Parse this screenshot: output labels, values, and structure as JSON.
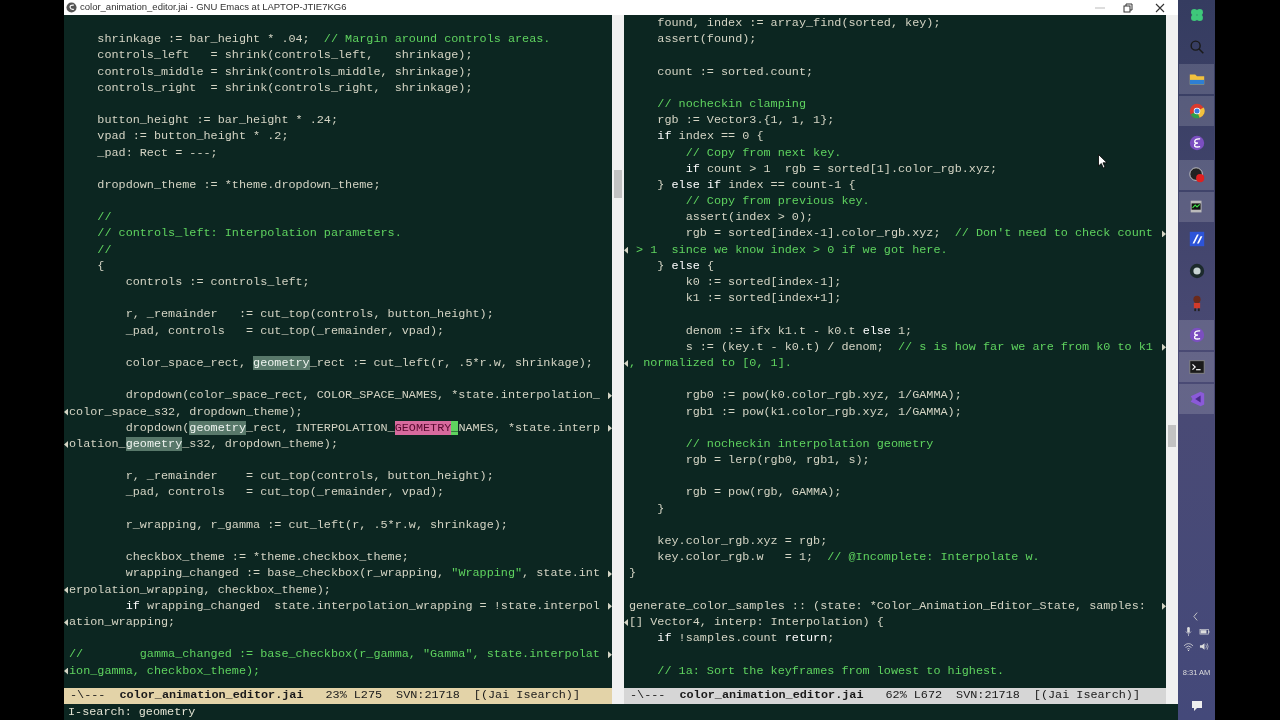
{
  "window": {
    "title": "color_animation_editor.jai - GNU Emacs at LAPTOP-JTIE7KG6"
  },
  "panes": [
    {
      "active": true,
      "lines": [
        {
          "kind": "blank"
        },
        {
          "kind": "text",
          "wraps": false,
          "continues": false,
          "segments": [
            {
              "kind": "code",
              "text": "    shrinkage := bar_height * .04;  "
            },
            {
              "kind": "comment",
              "text": "// Margin around controls areas."
            }
          ]
        },
        {
          "kind": "text",
          "wraps": false,
          "continues": false,
          "segments": [
            {
              "kind": "code",
              "text": "    controls_left   = shrink(controls_left,   shrinkage);"
            }
          ]
        },
        {
          "kind": "text",
          "wraps": false,
          "continues": false,
          "segments": [
            {
              "kind": "code",
              "text": "    controls_middle = shrink(controls_middle, shrinkage);"
            }
          ]
        },
        {
          "kind": "text",
          "wraps": false,
          "continues": false,
          "segments": [
            {
              "kind": "code",
              "text": "    controls_right  = shrink(controls_right,  shrinkage);"
            }
          ]
        },
        {
          "kind": "blank"
        },
        {
          "kind": "text",
          "wraps": false,
          "continues": false,
          "segments": [
            {
              "kind": "code",
              "text": "    button_height := bar_height * .24;"
            }
          ]
        },
        {
          "kind": "text",
          "wraps": false,
          "continues": false,
          "segments": [
            {
              "kind": "code",
              "text": "    vpad := button_height * .2;"
            }
          ]
        },
        {
          "kind": "text",
          "wraps": false,
          "continues": false,
          "segments": [
            {
              "kind": "code",
              "text": "    _pad: Rect = ---;"
            }
          ]
        },
        {
          "kind": "blank"
        },
        {
          "kind": "text",
          "wraps": false,
          "continues": false,
          "segments": [
            {
              "kind": "code",
              "text": "    dropdown_theme := *theme.dropdown_theme;"
            }
          ]
        },
        {
          "kind": "blank"
        },
        {
          "kind": "text",
          "wraps": false,
          "continues": false,
          "segments": [
            {
              "kind": "comment",
              "text": "    //"
            }
          ]
        },
        {
          "kind": "text",
          "wraps": false,
          "continues": false,
          "segments": [
            {
              "kind": "comment",
              "text": "    // controls_left: Interpolation parameters."
            }
          ]
        },
        {
          "kind": "text",
          "wraps": false,
          "continues": false,
          "segments": [
            {
              "kind": "comment",
              "text": "    //"
            }
          ]
        },
        {
          "kind": "text",
          "wraps": false,
          "continues": false,
          "segments": [
            {
              "kind": "code",
              "text": "    {"
            }
          ]
        },
        {
          "kind": "text",
          "wraps": false,
          "continues": false,
          "segments": [
            {
              "kind": "code",
              "text": "        controls := controls_left;"
            }
          ]
        },
        {
          "kind": "blank"
        },
        {
          "kind": "text",
          "wraps": false,
          "continues": false,
          "segments": [
            {
              "kind": "code",
              "text": "        r, _remainder   := cut_top(controls, button_height);"
            }
          ]
        },
        {
          "kind": "text",
          "wraps": false,
          "continues": false,
          "segments": [
            {
              "kind": "code",
              "text": "        _pad, controls   = cut_top(_remainder, vpad);"
            }
          ]
        },
        {
          "kind": "blank"
        },
        {
          "kind": "text",
          "wraps": false,
          "continues": false,
          "segments": [
            {
              "kind": "code",
              "text": "        color_space_rect, "
            },
            {
              "kind": "match",
              "text": "geometry"
            },
            {
              "kind": "code",
              "text": "_rect := cut_left(r, .5*r.w, shrinkage);"
            }
          ]
        },
        {
          "kind": "blank"
        },
        {
          "kind": "text",
          "wraps": true,
          "continues": false,
          "segments": [
            {
              "kind": "code",
              "text": "        dropdown(color_space_rect, COLOR_SPACE_NAMES, *state.interpolation_"
            }
          ]
        },
        {
          "kind": "text",
          "wraps": false,
          "continues": true,
          "segments": [
            {
              "kind": "code",
              "text": "color_space_s32, dropdown_theme);"
            }
          ]
        },
        {
          "kind": "text",
          "wraps": true,
          "continues": false,
          "segments": [
            {
              "kind": "code",
              "text": "        dropdown("
            },
            {
              "kind": "match",
              "text": "geometry"
            },
            {
              "kind": "code",
              "text": "_rect, INTERPOLATION_"
            },
            {
              "kind": "current",
              "text": "GEOMETRY"
            },
            {
              "kind": "cursor",
              "text": "_"
            },
            {
              "kind": "code",
              "text": "NAMES, *state.interp"
            }
          ]
        },
        {
          "kind": "text",
          "wraps": false,
          "continues": true,
          "segments": [
            {
              "kind": "code",
              "text": "olation_"
            },
            {
              "kind": "match",
              "text": "geometry"
            },
            {
              "kind": "code",
              "text": "_s32, dropdown_theme);"
            }
          ]
        },
        {
          "kind": "blank"
        },
        {
          "kind": "text",
          "wraps": false,
          "continues": false,
          "segments": [
            {
              "kind": "code",
              "text": "        r, _remainder    = cut_top(controls, button_height);"
            }
          ]
        },
        {
          "kind": "text",
          "wraps": false,
          "continues": false,
          "segments": [
            {
              "kind": "code",
              "text": "        _pad, controls   = cut_top(_remainder, vpad);"
            }
          ]
        },
        {
          "kind": "blank"
        },
        {
          "kind": "text",
          "wraps": false,
          "continues": false,
          "segments": [
            {
              "kind": "code",
              "text": "        r_wrapping, r_gamma := cut_left(r, .5*r.w, shrinkage);"
            }
          ]
        },
        {
          "kind": "blank"
        },
        {
          "kind": "text",
          "wraps": false,
          "continues": false,
          "segments": [
            {
              "kind": "code",
              "text": "        checkbox_theme := *theme.checkbox_theme;"
            }
          ]
        },
        {
          "kind": "text",
          "wraps": true,
          "continues": false,
          "segments": [
            {
              "kind": "code",
              "text": "        wrapping_changed := base_checkbox(r_wrapping, "
            },
            {
              "kind": "string",
              "text": "\"Wrapping\""
            },
            {
              "kind": "code",
              "text": ", state.int"
            }
          ]
        },
        {
          "kind": "text",
          "wraps": false,
          "continues": true,
          "segments": [
            {
              "kind": "code",
              "text": "erpolation_wrapping, checkbox_theme);"
            }
          ]
        },
        {
          "kind": "text",
          "wraps": true,
          "continues": false,
          "segments": [
            {
              "kind": "keyword",
              "text": "        if"
            },
            {
              "kind": "code",
              "text": " wrapping_changed  state.interpolation_wrapping = !state.interpol"
            }
          ]
        },
        {
          "kind": "text",
          "wraps": false,
          "continues": true,
          "segments": [
            {
              "kind": "code",
              "text": "ation_wrapping;"
            }
          ]
        },
        {
          "kind": "blank"
        },
        {
          "kind": "text",
          "wraps": true,
          "continues": false,
          "segments": [
            {
              "kind": "comment",
              "text": "//        gamma_changed := base_checkbox(r_gamma, \"Gamma\", state.interpolat"
            }
          ]
        },
        {
          "kind": "text",
          "wraps": false,
          "continues": true,
          "segments": [
            {
              "kind": "comment",
              "text": "ion_gamma, checkbox_theme);"
            }
          ]
        }
      ],
      "mode_line": {
        "status": "-\\---",
        "buffer": "color_animation_editor.jai",
        "position": "23% L275",
        "vc": "SVN:21718",
        "mode": "[(Jai Isearch)]"
      }
    },
    {
      "active": false,
      "lines": [
        {
          "kind": "text",
          "wraps": false,
          "continues": false,
          "segments": [
            {
              "kind": "code",
              "text": "    found, index := array_find(sorted, key);"
            }
          ]
        },
        {
          "kind": "text",
          "wraps": false,
          "continues": false,
          "segments": [
            {
              "kind": "code",
              "text": "    assert(found);"
            }
          ]
        },
        {
          "kind": "blank"
        },
        {
          "kind": "text",
          "wraps": false,
          "continues": false,
          "segments": [
            {
              "kind": "code",
              "text": "    count := sorted.count;"
            }
          ]
        },
        {
          "kind": "blank"
        },
        {
          "kind": "text",
          "wraps": false,
          "continues": false,
          "segments": [
            {
              "kind": "comment",
              "text": "    // nocheckin clamping"
            }
          ]
        },
        {
          "kind": "text",
          "wraps": false,
          "continues": false,
          "segments": [
            {
              "kind": "code",
              "text": "    rgb := Vector3.{1, 1, 1};"
            }
          ]
        },
        {
          "kind": "text",
          "wraps": false,
          "continues": false,
          "segments": [
            {
              "kind": "keyword",
              "text": "    if"
            },
            {
              "kind": "code",
              "text": " index == 0 {"
            }
          ]
        },
        {
          "kind": "text",
          "wraps": false,
          "continues": false,
          "segments": [
            {
              "kind": "comment",
              "text": "        // Copy from next key."
            }
          ]
        },
        {
          "kind": "text",
          "wraps": false,
          "continues": false,
          "segments": [
            {
              "kind": "keyword",
              "text": "        if"
            },
            {
              "kind": "code",
              "text": " count > 1  rgb = sorted[1].color_rgb.xyz;"
            }
          ]
        },
        {
          "kind": "text",
          "wraps": false,
          "continues": false,
          "segments": [
            {
              "kind": "code",
              "text": "    } "
            },
            {
              "kind": "keyword",
              "text": "else if"
            },
            {
              "kind": "code",
              "text": " index == count-1 {"
            }
          ]
        },
        {
          "kind": "text",
          "wraps": false,
          "continues": false,
          "segments": [
            {
              "kind": "comment",
              "text": "        // Copy from previous key."
            }
          ]
        },
        {
          "kind": "text",
          "wraps": false,
          "continues": false,
          "segments": [
            {
              "kind": "code",
              "text": "        assert(index > 0);"
            }
          ]
        },
        {
          "kind": "text",
          "wraps": true,
          "continues": false,
          "segments": [
            {
              "kind": "code",
              "text": "        rgb = sorted[index-1].color_rgb.xyz;  "
            },
            {
              "kind": "comment",
              "text": "// Don't need to check count"
            }
          ]
        },
        {
          "kind": "text",
          "wraps": false,
          "continues": true,
          "segments": [
            {
              "kind": "comment",
              "text": " > 1  since we know index > 0 if we got here."
            }
          ]
        },
        {
          "kind": "text",
          "wraps": false,
          "continues": false,
          "segments": [
            {
              "kind": "code",
              "text": "    } "
            },
            {
              "kind": "keyword",
              "text": "else"
            },
            {
              "kind": "code",
              "text": " {"
            }
          ]
        },
        {
          "kind": "text",
          "wraps": false,
          "continues": false,
          "segments": [
            {
              "kind": "code",
              "text": "        k0 := sorted[index-1];"
            }
          ]
        },
        {
          "kind": "text",
          "wraps": false,
          "continues": false,
          "segments": [
            {
              "kind": "code",
              "text": "        k1 := sorted[index+1];"
            }
          ]
        },
        {
          "kind": "blank"
        },
        {
          "kind": "text",
          "wraps": false,
          "continues": false,
          "segments": [
            {
              "kind": "code",
              "text": "        denom := ifx k1.t - k0.t "
            },
            {
              "kind": "keyword",
              "text": "else"
            },
            {
              "kind": "code",
              "text": " 1;"
            }
          ]
        },
        {
          "kind": "text",
          "wraps": true,
          "continues": false,
          "segments": [
            {
              "kind": "code",
              "text": "        s := (key.t - k0.t) / denom;  "
            },
            {
              "kind": "comment",
              "text": "// s is how far we are from k0 to k1"
            }
          ]
        },
        {
          "kind": "text",
          "wraps": false,
          "continues": true,
          "segments": [
            {
              "kind": "comment",
              "text": ", normalized to [0, 1]."
            }
          ]
        },
        {
          "kind": "blank"
        },
        {
          "kind": "text",
          "wraps": false,
          "continues": false,
          "segments": [
            {
              "kind": "code",
              "text": "        rgb0 := pow(k0.color_rgb.xyz, 1/GAMMA);"
            }
          ]
        },
        {
          "kind": "text",
          "wraps": false,
          "continues": false,
          "segments": [
            {
              "kind": "code",
              "text": "        rgb1 := pow(k1.color_rgb.xyz, 1/GAMMA);"
            }
          ]
        },
        {
          "kind": "blank"
        },
        {
          "kind": "text",
          "wraps": false,
          "continues": false,
          "segments": [
            {
              "kind": "comment",
              "text": "        // nocheckin interpolation geometry"
            }
          ]
        },
        {
          "kind": "text",
          "wraps": false,
          "continues": false,
          "segments": [
            {
              "kind": "code",
              "text": "        rgb = lerp(rgb0, rgb1, s);"
            }
          ]
        },
        {
          "kind": "blank"
        },
        {
          "kind": "text",
          "wraps": false,
          "continues": false,
          "segments": [
            {
              "kind": "code",
              "text": "        rgb = pow(rgb, GAMMA);"
            }
          ]
        },
        {
          "kind": "text",
          "wraps": false,
          "continues": false,
          "segments": [
            {
              "kind": "code",
              "text": "    }"
            }
          ]
        },
        {
          "kind": "blank"
        },
        {
          "kind": "text",
          "wraps": false,
          "continues": false,
          "segments": [
            {
              "kind": "code",
              "text": "    key.color_rgb.xyz = rgb;"
            }
          ]
        },
        {
          "kind": "text",
          "wraps": false,
          "continues": false,
          "segments": [
            {
              "kind": "code",
              "text": "    key.color_rgb.w   = 1;  "
            },
            {
              "kind": "comment",
              "text": "// @Incomplete: Interpolate w."
            }
          ]
        },
        {
          "kind": "text",
          "wraps": false,
          "continues": false,
          "segments": [
            {
              "kind": "code",
              "text": "}"
            }
          ]
        },
        {
          "kind": "blank"
        },
        {
          "kind": "text",
          "wraps": true,
          "continues": false,
          "segments": [
            {
              "kind": "code",
              "text": "generate_color_samples :: (state: *Color_Animation_Editor_State, samples: "
            }
          ]
        },
        {
          "kind": "text",
          "wraps": false,
          "continues": true,
          "segments": [
            {
              "kind": "code",
              "text": "[] Vector4, interp: Interpolation) {"
            }
          ]
        },
        {
          "kind": "text",
          "wraps": false,
          "continues": false,
          "segments": [
            {
              "kind": "keyword",
              "text": "    if"
            },
            {
              "kind": "code",
              "text": " !samples.count "
            },
            {
              "kind": "keyword",
              "text": "return"
            },
            {
              "kind": "code",
              "text": ";"
            }
          ]
        },
        {
          "kind": "blank"
        },
        {
          "kind": "text",
          "wraps": false,
          "continues": false,
          "segments": [
            {
              "kind": "comment",
              "text": "    // 1a: Sort the keyframes from lowest to highest."
            }
          ]
        }
      ],
      "mode_line": {
        "status": "-\\---",
        "buffer": "color_animation_editor.jai",
        "position": "62% L672",
        "vc": "SVN:21718",
        "mode": "[(Jai Isearch)]"
      }
    }
  ],
  "minibuffer": {
    "text": "I-search: geometry"
  },
  "taskbar": {
    "apps": [
      {
        "kind": "clover",
        "running": false
      },
      {
        "kind": "search",
        "running": false
      },
      {
        "kind": "folder",
        "running": true
      },
      {
        "kind": "browser",
        "running": true
      },
      {
        "kind": "emacs",
        "running": false
      },
      {
        "kind": "record",
        "running": true
      },
      {
        "kind": "monitor",
        "running": true
      },
      {
        "kind": "tile",
        "running": false
      },
      {
        "kind": "ring",
        "running": false
      },
      {
        "kind": "figure",
        "running": false
      },
      {
        "kind": "emacs",
        "running": true
      },
      {
        "kind": "terminal",
        "running": true
      },
      {
        "kind": "ribbon",
        "running": true
      }
    ],
    "tray": [
      {
        "kind": "chevron"
      },
      {
        "kind": "mic"
      },
      {
        "kind": "battery"
      },
      {
        "kind": "wifi"
      },
      {
        "kind": "volume"
      }
    ],
    "clock": "8:31 AM"
  }
}
